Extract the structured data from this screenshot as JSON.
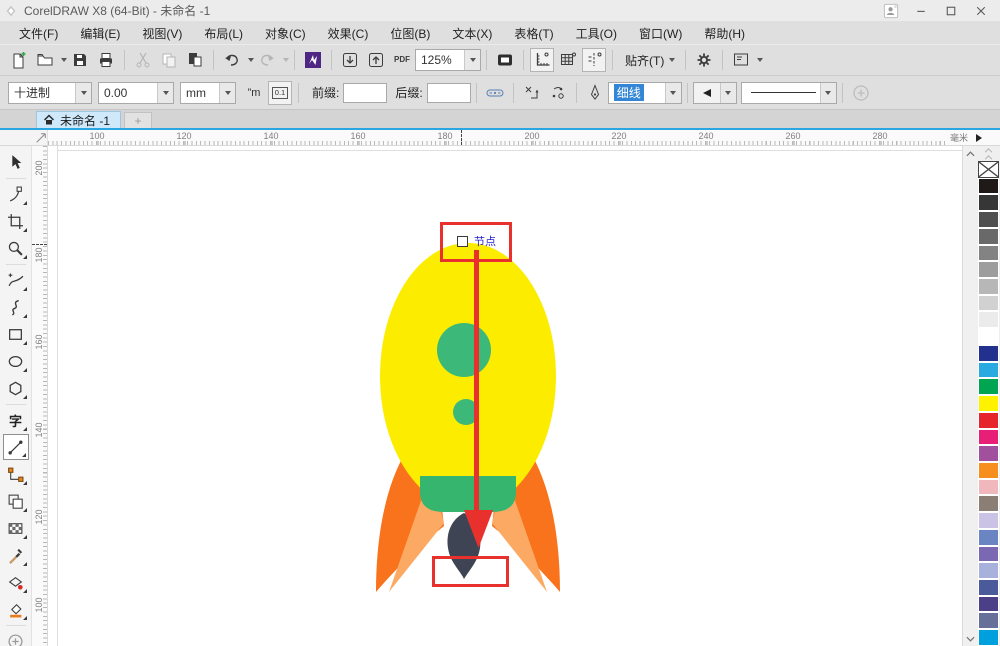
{
  "window": {
    "title": "CorelDRAW X8 (64-Bit) - 未命名 -1"
  },
  "menu": {
    "items": [
      "文件(F)",
      "编辑(E)",
      "视图(V)",
      "布局(L)",
      "对象(C)",
      "效果(C)",
      "位图(B)",
      "文本(X)",
      "表格(T)",
      "工具(O)",
      "窗口(W)",
      "帮助(H)"
    ]
  },
  "toolbar": {
    "zoom_level": "125%",
    "pdf_label": "PDF",
    "snap_label": "贴齐(T)",
    "icons": [
      "new-document",
      "open",
      "save",
      "print",
      "cut",
      "copy",
      "paste",
      "undo",
      "redo",
      "application-launcher",
      "import",
      "export",
      "publish-pdf",
      "zoom-levels",
      "full-screen-preview",
      "view-rulers",
      "view-grid",
      "view-guidelines",
      "snap-to",
      "options-gear",
      "window-layout"
    ]
  },
  "property_bar": {
    "dimension_style": "十进制",
    "dimension_precision": "0.00",
    "dimension_units": "mm",
    "show_units_glyph": "”m",
    "precision_glyph": "0.1",
    "prefix_label": "前缀:",
    "suffix_label": "后缀:",
    "prefix_value": "",
    "suffix_value": "",
    "outline_width": "细线"
  },
  "document_tabs": {
    "active": "未命名 -1",
    "new_tab_glyph": "+"
  },
  "rulers": {
    "horizontal": [
      "100",
      "120",
      "140",
      "160",
      "180",
      "200",
      "220",
      "240",
      "260",
      "280"
    ],
    "vertical": [
      "200",
      "180",
      "160",
      "140",
      "120",
      "100"
    ],
    "units_label": "毫米"
  },
  "toolbox": {
    "text_tool_glyph": "字",
    "tools": [
      "pick-tool",
      "shape-tool",
      "crop-tool",
      "zoom-tool",
      "freehand-tool",
      "curve-tool",
      "rectangle-tool",
      "ellipse-tool",
      "polygon-tool",
      "text-tool",
      "dimension-tool",
      "connector-tool",
      "contour-tool",
      "transparency-tool",
      "eyedropper-tool",
      "smart-fill-tool",
      "fill-tool",
      "more-tools"
    ]
  },
  "palette": {
    "colors": [
      "#1f1a17",
      "#363636",
      "#4f4f4f",
      "#696969",
      "#838383",
      "#9d9d9d",
      "#b7b7b7",
      "#d1d1d1",
      "#ebebeb",
      "#ffffff",
      "#22318e",
      "#2aaae1",
      "#00a551",
      "#fef200",
      "#e6242b",
      "#e81f77",
      "#a1509e",
      "#f78f1e",
      "#f0b8bd",
      "#8b7e74",
      "#cbc3e6",
      "#6b85c2",
      "#7a69b2",
      "#a7b1dc",
      "#4a5a9b",
      "#4b3f87",
      "#677098",
      "#00a0de"
    ]
  },
  "canvas": {
    "annotation_label": "节点",
    "annotation_color": "#e8312c",
    "rocket_colors": {
      "body": "#fcec00",
      "windows": "#3cb878",
      "base": "#35b56d",
      "fins_dark": "#f9731c",
      "fins_light": "#fcaa63",
      "flame": "#3e4454"
    }
  }
}
